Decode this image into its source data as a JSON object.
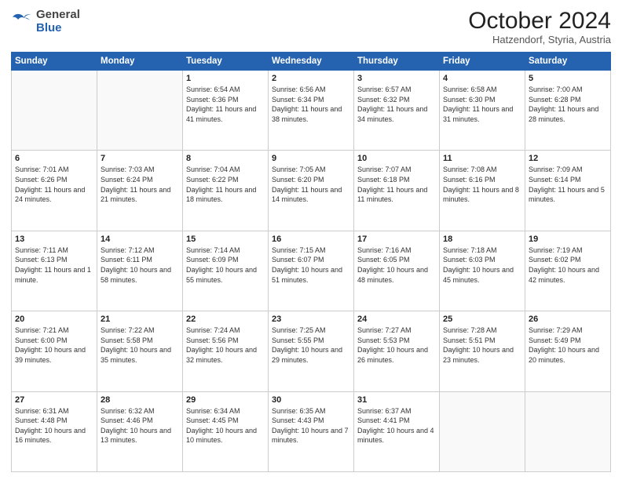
{
  "header": {
    "logo_general": "General",
    "logo_blue": "Blue",
    "month_title": "October 2024",
    "subtitle": "Hatzendorf, Styria, Austria"
  },
  "weekdays": [
    "Sunday",
    "Monday",
    "Tuesday",
    "Wednesday",
    "Thursday",
    "Friday",
    "Saturday"
  ],
  "weeks": [
    [
      {
        "day": "",
        "sunrise": "",
        "sunset": "",
        "daylight": ""
      },
      {
        "day": "",
        "sunrise": "",
        "sunset": "",
        "daylight": ""
      },
      {
        "day": "1",
        "sunrise": "Sunrise: 6:54 AM",
        "sunset": "Sunset: 6:36 PM",
        "daylight": "Daylight: 11 hours and 41 minutes."
      },
      {
        "day": "2",
        "sunrise": "Sunrise: 6:56 AM",
        "sunset": "Sunset: 6:34 PM",
        "daylight": "Daylight: 11 hours and 38 minutes."
      },
      {
        "day": "3",
        "sunrise": "Sunrise: 6:57 AM",
        "sunset": "Sunset: 6:32 PM",
        "daylight": "Daylight: 11 hours and 34 minutes."
      },
      {
        "day": "4",
        "sunrise": "Sunrise: 6:58 AM",
        "sunset": "Sunset: 6:30 PM",
        "daylight": "Daylight: 11 hours and 31 minutes."
      },
      {
        "day": "5",
        "sunrise": "Sunrise: 7:00 AM",
        "sunset": "Sunset: 6:28 PM",
        "daylight": "Daylight: 11 hours and 28 minutes."
      }
    ],
    [
      {
        "day": "6",
        "sunrise": "Sunrise: 7:01 AM",
        "sunset": "Sunset: 6:26 PM",
        "daylight": "Daylight: 11 hours and 24 minutes."
      },
      {
        "day": "7",
        "sunrise": "Sunrise: 7:03 AM",
        "sunset": "Sunset: 6:24 PM",
        "daylight": "Daylight: 11 hours and 21 minutes."
      },
      {
        "day": "8",
        "sunrise": "Sunrise: 7:04 AM",
        "sunset": "Sunset: 6:22 PM",
        "daylight": "Daylight: 11 hours and 18 minutes."
      },
      {
        "day": "9",
        "sunrise": "Sunrise: 7:05 AM",
        "sunset": "Sunset: 6:20 PM",
        "daylight": "Daylight: 11 hours and 14 minutes."
      },
      {
        "day": "10",
        "sunrise": "Sunrise: 7:07 AM",
        "sunset": "Sunset: 6:18 PM",
        "daylight": "Daylight: 11 hours and 11 minutes."
      },
      {
        "day": "11",
        "sunrise": "Sunrise: 7:08 AM",
        "sunset": "Sunset: 6:16 PM",
        "daylight": "Daylight: 11 hours and 8 minutes."
      },
      {
        "day": "12",
        "sunrise": "Sunrise: 7:09 AM",
        "sunset": "Sunset: 6:14 PM",
        "daylight": "Daylight: 11 hours and 5 minutes."
      }
    ],
    [
      {
        "day": "13",
        "sunrise": "Sunrise: 7:11 AM",
        "sunset": "Sunset: 6:13 PM",
        "daylight": "Daylight: 11 hours and 1 minute."
      },
      {
        "day": "14",
        "sunrise": "Sunrise: 7:12 AM",
        "sunset": "Sunset: 6:11 PM",
        "daylight": "Daylight: 10 hours and 58 minutes."
      },
      {
        "day": "15",
        "sunrise": "Sunrise: 7:14 AM",
        "sunset": "Sunset: 6:09 PM",
        "daylight": "Daylight: 10 hours and 55 minutes."
      },
      {
        "day": "16",
        "sunrise": "Sunrise: 7:15 AM",
        "sunset": "Sunset: 6:07 PM",
        "daylight": "Daylight: 10 hours and 51 minutes."
      },
      {
        "day": "17",
        "sunrise": "Sunrise: 7:16 AM",
        "sunset": "Sunset: 6:05 PM",
        "daylight": "Daylight: 10 hours and 48 minutes."
      },
      {
        "day": "18",
        "sunrise": "Sunrise: 7:18 AM",
        "sunset": "Sunset: 6:03 PM",
        "daylight": "Daylight: 10 hours and 45 minutes."
      },
      {
        "day": "19",
        "sunrise": "Sunrise: 7:19 AM",
        "sunset": "Sunset: 6:02 PM",
        "daylight": "Daylight: 10 hours and 42 minutes."
      }
    ],
    [
      {
        "day": "20",
        "sunrise": "Sunrise: 7:21 AM",
        "sunset": "Sunset: 6:00 PM",
        "daylight": "Daylight: 10 hours and 39 minutes."
      },
      {
        "day": "21",
        "sunrise": "Sunrise: 7:22 AM",
        "sunset": "Sunset: 5:58 PM",
        "daylight": "Daylight: 10 hours and 35 minutes."
      },
      {
        "day": "22",
        "sunrise": "Sunrise: 7:24 AM",
        "sunset": "Sunset: 5:56 PM",
        "daylight": "Daylight: 10 hours and 32 minutes."
      },
      {
        "day": "23",
        "sunrise": "Sunrise: 7:25 AM",
        "sunset": "Sunset: 5:55 PM",
        "daylight": "Daylight: 10 hours and 29 minutes."
      },
      {
        "day": "24",
        "sunrise": "Sunrise: 7:27 AM",
        "sunset": "Sunset: 5:53 PM",
        "daylight": "Daylight: 10 hours and 26 minutes."
      },
      {
        "day": "25",
        "sunrise": "Sunrise: 7:28 AM",
        "sunset": "Sunset: 5:51 PM",
        "daylight": "Daylight: 10 hours and 23 minutes."
      },
      {
        "day": "26",
        "sunrise": "Sunrise: 7:29 AM",
        "sunset": "Sunset: 5:49 PM",
        "daylight": "Daylight: 10 hours and 20 minutes."
      }
    ],
    [
      {
        "day": "27",
        "sunrise": "Sunrise: 6:31 AM",
        "sunset": "Sunset: 4:48 PM",
        "daylight": "Daylight: 10 hours and 16 minutes."
      },
      {
        "day": "28",
        "sunrise": "Sunrise: 6:32 AM",
        "sunset": "Sunset: 4:46 PM",
        "daylight": "Daylight: 10 hours and 13 minutes."
      },
      {
        "day": "29",
        "sunrise": "Sunrise: 6:34 AM",
        "sunset": "Sunset: 4:45 PM",
        "daylight": "Daylight: 10 hours and 10 minutes."
      },
      {
        "day": "30",
        "sunrise": "Sunrise: 6:35 AM",
        "sunset": "Sunset: 4:43 PM",
        "daylight": "Daylight: 10 hours and 7 minutes."
      },
      {
        "day": "31",
        "sunrise": "Sunrise: 6:37 AM",
        "sunset": "Sunset: 4:41 PM",
        "daylight": "Daylight: 10 hours and 4 minutes."
      },
      {
        "day": "",
        "sunrise": "",
        "sunset": "",
        "daylight": ""
      },
      {
        "day": "",
        "sunrise": "",
        "sunset": "",
        "daylight": ""
      }
    ]
  ]
}
